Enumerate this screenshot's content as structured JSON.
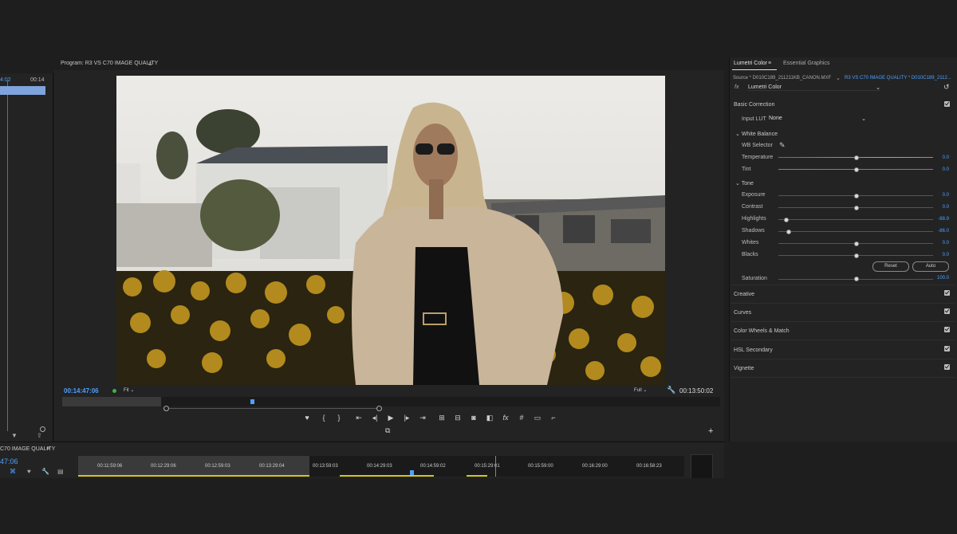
{
  "left_panel": {
    "timecode_current": "4:02",
    "timecode_end": "00:14"
  },
  "program_monitor": {
    "title": "Program: R3 VS C70 IMAGE QUALITY",
    "menu_icon": "hamburger-icon",
    "current_timecode": "00:14:47:06",
    "fit_label": "Fit",
    "quality_label": "Full",
    "duration_timecode": "00:13:50:02",
    "transport": [
      "marker-icon",
      "mark-in-icon",
      "mark-out-icon",
      "go-to-in-icon",
      "step-back-icon",
      "play-icon",
      "step-forward-icon",
      "go-to-out-icon",
      "insert-icon",
      "overwrite-icon",
      "export-frame-icon",
      "comparison-icon",
      "fx-icon",
      "safe-margins-icon",
      "multicam-icon",
      "crop-icon"
    ]
  },
  "lumetri": {
    "tab_active": "Lumetri Color",
    "tab_other": "Essential Graphics",
    "source_left": "Source * D010C189_211211KB_CANON.MXF",
    "source_right": "R3 VS C70 IMAGE QUALITY * D010C189_2112...",
    "fx_label": "fx",
    "effect_name": "Lumetri Color",
    "basic_correction": "Basic Correction",
    "input_lut_label": "Input LUT",
    "input_lut_value": "None",
    "white_balance": "White Balance",
    "wb_selector": "WB Selector",
    "temperature": {
      "label": "Temperature",
      "value": "0.0"
    },
    "tint": {
      "label": "Tint",
      "value": "0.0"
    },
    "tone": "Tone",
    "exposure": {
      "label": "Exposure",
      "value": "0.0"
    },
    "contrast": {
      "label": "Contrast",
      "value": "0.0"
    },
    "highlights": {
      "label": "Highlights",
      "value": "-88.9"
    },
    "shadows": {
      "label": "Shadows",
      "value": "-86.0"
    },
    "whites": {
      "label": "Whites",
      "value": "0.0"
    },
    "blacks": {
      "label": "Blacks",
      "value": "0.0"
    },
    "reset_label": "Reset",
    "auto_label": "Auto",
    "saturation": {
      "label": "Saturation",
      "value": "100.0"
    },
    "sections": [
      "Creative",
      "Curves",
      "Color Wheels & Match",
      "HSL Secondary",
      "Vignette"
    ]
  },
  "timeline": {
    "title": "C70 IMAGE QUALITY",
    "timecode": "47:06",
    "ticks": [
      "00:11:59:06",
      "00:12:29:06",
      "00:12:59:03",
      "00:13:29:04",
      "00:13:59:03",
      "00:14:29:03",
      "00:14:59:02",
      "00:15:29:01",
      "00:15:59:00",
      "00:16:29:00",
      "00:16:58:23"
    ]
  },
  "colors": {
    "accent": "#4ea0ff",
    "panel": "#232323",
    "background": "#1e1e1e"
  }
}
